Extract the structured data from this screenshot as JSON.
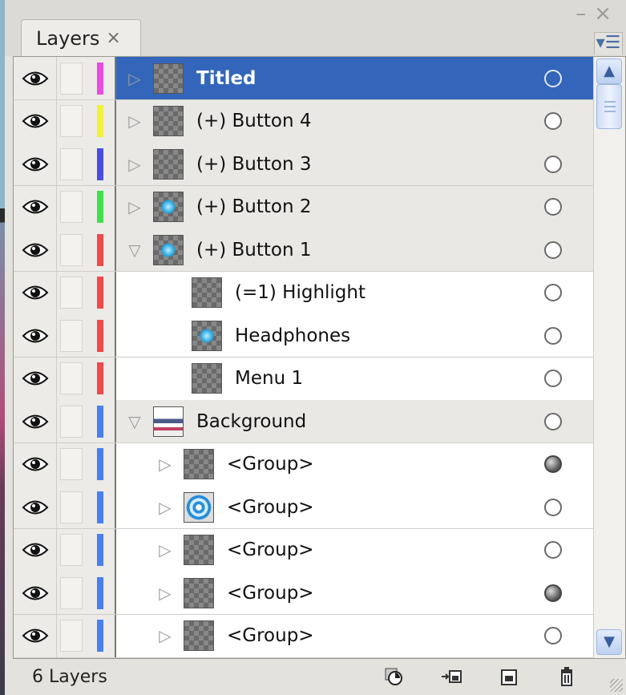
{
  "panel": {
    "tab_label": "Layers",
    "tab_close": "×",
    "minimize": "–",
    "close": "×",
    "menu_icon": "panel-menu-icon"
  },
  "layers": [
    {
      "name": "Titled",
      "color": "#e84de0",
      "level": 0,
      "expanded": false,
      "selected": true,
      "thumb": "plain",
      "target_filled": false
    },
    {
      "name": "(+) Button 4",
      "color": "#f2f23a",
      "level": 0,
      "expanded": false,
      "selected": false,
      "thumb": "plain",
      "target_filled": false
    },
    {
      "name": "(+) Button 3",
      "color": "#4a4ee0",
      "level": 0,
      "expanded": false,
      "selected": false,
      "thumb": "plain",
      "target_filled": false
    },
    {
      "name": "(+) Button 2",
      "color": "#3fe04a",
      "level": 0,
      "expanded": false,
      "selected": false,
      "thumb": "blue",
      "target_filled": false
    },
    {
      "name": "(+) Button 1",
      "color": "#f04a4a",
      "level": 0,
      "expanded": true,
      "selected": false,
      "thumb": "blue",
      "target_filled": false
    },
    {
      "name": "(=1) Highlight",
      "color": "#f04a4a",
      "level": 1,
      "expanded": null,
      "selected": false,
      "thumb": "plain",
      "target_filled": false
    },
    {
      "name": "Headphones",
      "color": "#f04a4a",
      "level": 1,
      "expanded": null,
      "selected": false,
      "thumb": "blue",
      "target_filled": false
    },
    {
      "name": "Menu 1",
      "color": "#f04a4a",
      "level": 1,
      "expanded": null,
      "selected": false,
      "thumb": "plain",
      "target_filled": false
    },
    {
      "name": "Background",
      "color": "#4a7ff0",
      "level": 0,
      "expanded": true,
      "selected": false,
      "thumb": "bg",
      "target_filled": false
    },
    {
      "name": "<Group>",
      "color": "#4a7ff0",
      "level": 1,
      "expanded": false,
      "selected": false,
      "thumb": "plain",
      "target_filled": true
    },
    {
      "name": "<Group>",
      "color": "#4a7ff0",
      "level": 1,
      "expanded": false,
      "selected": false,
      "thumb": "target",
      "target_filled": false
    },
    {
      "name": "<Group>",
      "color": "#4a7ff0",
      "level": 1,
      "expanded": false,
      "selected": false,
      "thumb": "plain",
      "target_filled": false
    },
    {
      "name": "<Group>",
      "color": "#4a7ff0",
      "level": 1,
      "expanded": false,
      "selected": false,
      "thumb": "plain",
      "target_filled": true
    },
    {
      "name": "<Group>",
      "color": "#4a7ff0",
      "level": 1,
      "expanded": false,
      "selected": false,
      "thumb": "plain",
      "target_filled": false
    }
  ],
  "footer": {
    "count_label": "6 Layers",
    "icons": [
      "make-clipping-mask-icon",
      "create-sublayer-icon",
      "new-layer-icon",
      "delete-layer-icon"
    ]
  },
  "colors": {
    "selection": "#3366bb",
    "accent": "#4a6fa5"
  }
}
